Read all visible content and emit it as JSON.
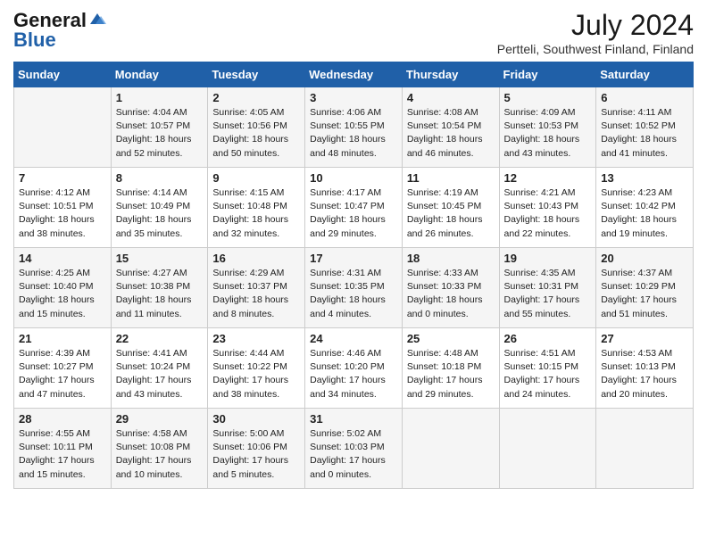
{
  "logo": {
    "general": "General",
    "blue": "Blue"
  },
  "header": {
    "month_year": "July 2024",
    "location": "Pertteli, Southwest Finland, Finland"
  },
  "weekdays": [
    "Sunday",
    "Monday",
    "Tuesday",
    "Wednesday",
    "Thursday",
    "Friday",
    "Saturday"
  ],
  "weeks": [
    [
      {
        "day": "",
        "info": ""
      },
      {
        "day": "1",
        "info": "Sunrise: 4:04 AM\nSunset: 10:57 PM\nDaylight: 18 hours\nand 52 minutes."
      },
      {
        "day": "2",
        "info": "Sunrise: 4:05 AM\nSunset: 10:56 PM\nDaylight: 18 hours\nand 50 minutes."
      },
      {
        "day": "3",
        "info": "Sunrise: 4:06 AM\nSunset: 10:55 PM\nDaylight: 18 hours\nand 48 minutes."
      },
      {
        "day": "4",
        "info": "Sunrise: 4:08 AM\nSunset: 10:54 PM\nDaylight: 18 hours\nand 46 minutes."
      },
      {
        "day": "5",
        "info": "Sunrise: 4:09 AM\nSunset: 10:53 PM\nDaylight: 18 hours\nand 43 minutes."
      },
      {
        "day": "6",
        "info": "Sunrise: 4:11 AM\nSunset: 10:52 PM\nDaylight: 18 hours\nand 41 minutes."
      }
    ],
    [
      {
        "day": "7",
        "info": "Sunrise: 4:12 AM\nSunset: 10:51 PM\nDaylight: 18 hours\nand 38 minutes."
      },
      {
        "day": "8",
        "info": "Sunrise: 4:14 AM\nSunset: 10:49 PM\nDaylight: 18 hours\nand 35 minutes."
      },
      {
        "day": "9",
        "info": "Sunrise: 4:15 AM\nSunset: 10:48 PM\nDaylight: 18 hours\nand 32 minutes."
      },
      {
        "day": "10",
        "info": "Sunrise: 4:17 AM\nSunset: 10:47 PM\nDaylight: 18 hours\nand 29 minutes."
      },
      {
        "day": "11",
        "info": "Sunrise: 4:19 AM\nSunset: 10:45 PM\nDaylight: 18 hours\nand 26 minutes."
      },
      {
        "day": "12",
        "info": "Sunrise: 4:21 AM\nSunset: 10:43 PM\nDaylight: 18 hours\nand 22 minutes."
      },
      {
        "day": "13",
        "info": "Sunrise: 4:23 AM\nSunset: 10:42 PM\nDaylight: 18 hours\nand 19 minutes."
      }
    ],
    [
      {
        "day": "14",
        "info": "Sunrise: 4:25 AM\nSunset: 10:40 PM\nDaylight: 18 hours\nand 15 minutes."
      },
      {
        "day": "15",
        "info": "Sunrise: 4:27 AM\nSunset: 10:38 PM\nDaylight: 18 hours\nand 11 minutes."
      },
      {
        "day": "16",
        "info": "Sunrise: 4:29 AM\nSunset: 10:37 PM\nDaylight: 18 hours\nand 8 minutes."
      },
      {
        "day": "17",
        "info": "Sunrise: 4:31 AM\nSunset: 10:35 PM\nDaylight: 18 hours\nand 4 minutes."
      },
      {
        "day": "18",
        "info": "Sunrise: 4:33 AM\nSunset: 10:33 PM\nDaylight: 18 hours\nand 0 minutes."
      },
      {
        "day": "19",
        "info": "Sunrise: 4:35 AM\nSunset: 10:31 PM\nDaylight: 17 hours\nand 55 minutes."
      },
      {
        "day": "20",
        "info": "Sunrise: 4:37 AM\nSunset: 10:29 PM\nDaylight: 17 hours\nand 51 minutes."
      }
    ],
    [
      {
        "day": "21",
        "info": "Sunrise: 4:39 AM\nSunset: 10:27 PM\nDaylight: 17 hours\nand 47 minutes."
      },
      {
        "day": "22",
        "info": "Sunrise: 4:41 AM\nSunset: 10:24 PM\nDaylight: 17 hours\nand 43 minutes."
      },
      {
        "day": "23",
        "info": "Sunrise: 4:44 AM\nSunset: 10:22 PM\nDaylight: 17 hours\nand 38 minutes."
      },
      {
        "day": "24",
        "info": "Sunrise: 4:46 AM\nSunset: 10:20 PM\nDaylight: 17 hours\nand 34 minutes."
      },
      {
        "day": "25",
        "info": "Sunrise: 4:48 AM\nSunset: 10:18 PM\nDaylight: 17 hours\nand 29 minutes."
      },
      {
        "day": "26",
        "info": "Sunrise: 4:51 AM\nSunset: 10:15 PM\nDaylight: 17 hours\nand 24 minutes."
      },
      {
        "day": "27",
        "info": "Sunrise: 4:53 AM\nSunset: 10:13 PM\nDaylight: 17 hours\nand 20 minutes."
      }
    ],
    [
      {
        "day": "28",
        "info": "Sunrise: 4:55 AM\nSunset: 10:11 PM\nDaylight: 17 hours\nand 15 minutes."
      },
      {
        "day": "29",
        "info": "Sunrise: 4:58 AM\nSunset: 10:08 PM\nDaylight: 17 hours\nand 10 minutes."
      },
      {
        "day": "30",
        "info": "Sunrise: 5:00 AM\nSunset: 10:06 PM\nDaylight: 17 hours\nand 5 minutes."
      },
      {
        "day": "31",
        "info": "Sunrise: 5:02 AM\nSunset: 10:03 PM\nDaylight: 17 hours\nand 0 minutes."
      },
      {
        "day": "",
        "info": ""
      },
      {
        "day": "",
        "info": ""
      },
      {
        "day": "",
        "info": ""
      }
    ]
  ]
}
